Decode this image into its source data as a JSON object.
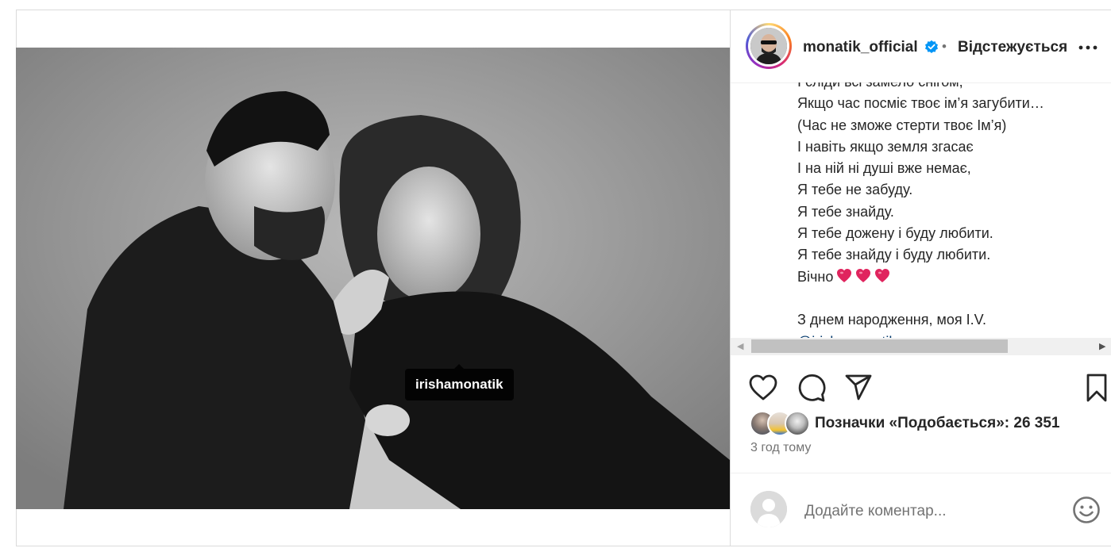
{
  "post": {
    "author": {
      "username": "monatik_official",
      "verified": true,
      "separator": "•",
      "follow_status": "Відстежується"
    },
    "media": {
      "tag_username": "irishamonatik"
    },
    "caption_lines": [
      "І сліди всі замело снігом,",
      "Якщо час посміє твоє ім’я загубити…",
      "(Час не зможе стерти твоє Ім’я)",
      "І навіть якщо земля згасає",
      "І на ній ні душі вже немає,",
      "Я тебе не забуду.",
      "Я тебе знайду.",
      "Я тебе дожену і буду любити.",
      "Я тебе знайду і буду любити.",
      "Вічно",
      "",
      "З днем народження, моя I.V.",
      "@irishamonatik"
    ],
    "likes": {
      "label": "Позначки «Подобається»: 26 351"
    },
    "time_ago": "3 год тому",
    "comment": {
      "placeholder": "Додайте коментар..."
    }
  },
  "colors": {
    "text": "#262626",
    "secondary": "#737373",
    "verified_blue": "#0095f6",
    "heart_red": "#e0245e"
  },
  "icons": [
    "more-icon",
    "verified-icon",
    "tags-icon",
    "like-icon",
    "comment-icon",
    "share-icon",
    "save-icon",
    "emoji-icon",
    "heart-emoji"
  ]
}
